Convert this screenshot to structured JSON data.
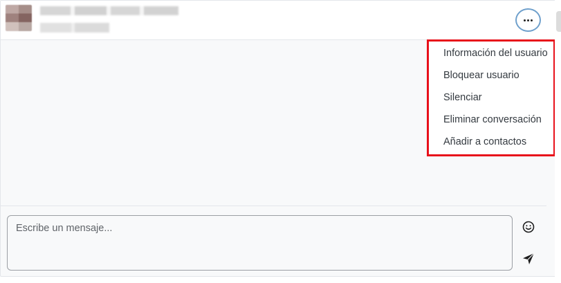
{
  "header": {
    "more_menu_button": {
      "icon": "more-horizontal-icon"
    }
  },
  "dropdown": {
    "items": [
      {
        "label": "Información del usuario"
      },
      {
        "label": "Bloquear usuario"
      },
      {
        "label": "Silenciar"
      },
      {
        "label": "Eliminar conversación"
      },
      {
        "label": "Añadir a contactos"
      }
    ],
    "highlight_color": "#e8101a"
  },
  "composer": {
    "placeholder": "Escribe un mensaje...",
    "emoji_icon": "smile-icon",
    "send_icon": "send-icon"
  }
}
